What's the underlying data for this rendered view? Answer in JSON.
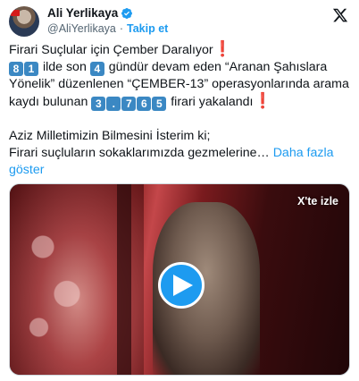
{
  "author": {
    "name": "Ali Yerlikaya",
    "handle": "@AliYerlikaya",
    "separator": "·",
    "follow_label": "Takip et"
  },
  "tweet": {
    "line1_text": "Firari Suçlular için Çember Daralıyor",
    "line2": {
      "digits_a": [
        "8",
        "1"
      ],
      "text_a": " ilde son ",
      "digit_b": "4",
      "text_b": " gündür devam eden “Aranan Şahıslara Yönelik” düzenlenen “ÇEMBER-13” operasyonlarında arama kaydı bulunan ",
      "digits_c": [
        "3",
        ".",
        "7",
        "6",
        "5"
      ],
      "text_c": " firari yakalandı"
    },
    "para2_line1": "Aziz Milletimizin Bilmesini İsterim ki;",
    "para2_line2": "Firari suçluların sokaklarımızda gezmelerine…",
    "show_more": "Daha fazla göster"
  },
  "media": {
    "watch_on_x": "X'te izle",
    "play_icon": "play-icon"
  },
  "colors": {
    "accent": "#1d9bf0",
    "text": "#0f1419",
    "muted": "#536471",
    "keycap": "#3b88c3",
    "exclamation": "#e0252b"
  }
}
